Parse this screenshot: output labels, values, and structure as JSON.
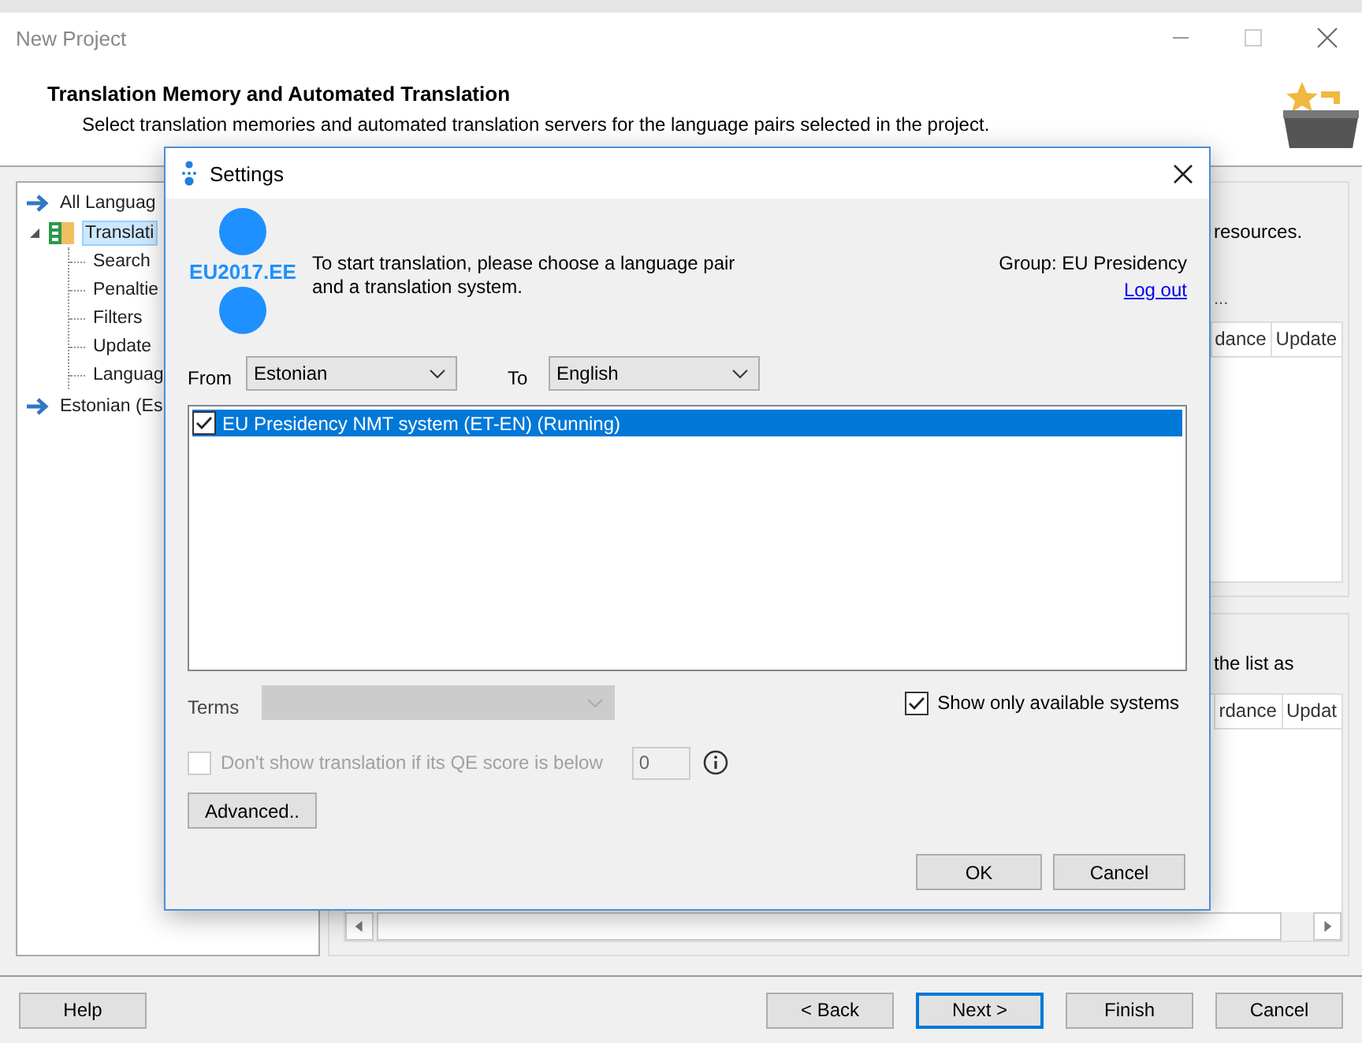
{
  "window": {
    "title": "New Project",
    "header_title": "Translation Memory and Automated Translation",
    "header_subtitle": "Select translation memories and automated translation servers for the language pairs selected in the project."
  },
  "tree": [
    {
      "label": "All Languag",
      "kind": "arrow",
      "selected": false
    },
    {
      "label": "Translati",
      "kind": "group",
      "selected": true,
      "expanded": true,
      "children": [
        {
          "label": "Search"
        },
        {
          "label": "Penaltie"
        },
        {
          "label": "Filters"
        },
        {
          "label": "Update"
        },
        {
          "label": "Languag"
        }
      ]
    },
    {
      "label": "Estonian (Es",
      "kind": "arrow",
      "selected": false
    }
  ],
  "panels": [
    {
      "text": "resources.",
      "note": "...",
      "columns": [
        "dance",
        "Update"
      ]
    },
    {
      "text": "the list as",
      "columns": [
        "rdance",
        "Updat"
      ],
      "hscroll": true
    }
  ],
  "dialog": {
    "title": "Settings",
    "logo": "EU2017.EE",
    "instruction": "To start translation, please choose a language pair and a translation system.",
    "group": "Group: EU Presidency",
    "logout": "Log out",
    "from": {
      "label": "From",
      "value": "Estonian"
    },
    "to": {
      "label": "To",
      "value": "English"
    },
    "systems": [
      {
        "label": "EU Presidency NMT system (ET-EN) (Running)",
        "checked": true,
        "selected": true
      }
    ],
    "terms": {
      "label": "Terms",
      "disabled": true
    },
    "show_available": {
      "label": "Show only available systems",
      "checked": true
    },
    "qe": {
      "label": "Don't show translation if its QE score is below",
      "checked": false,
      "disabled": true,
      "value": "0"
    },
    "advanced": "Advanced..",
    "ok": "OK",
    "cancel": "Cancel"
  },
  "left_buttons": [
    {
      "label": "Help",
      "default": false
    }
  ],
  "right_buttons": [
    {
      "label": "< Back",
      "default": false
    },
    {
      "label": "Next >",
      "default": true
    },
    {
      "label": "Finish",
      "default": false
    },
    {
      "label": "Cancel",
      "default": false
    }
  ]
}
